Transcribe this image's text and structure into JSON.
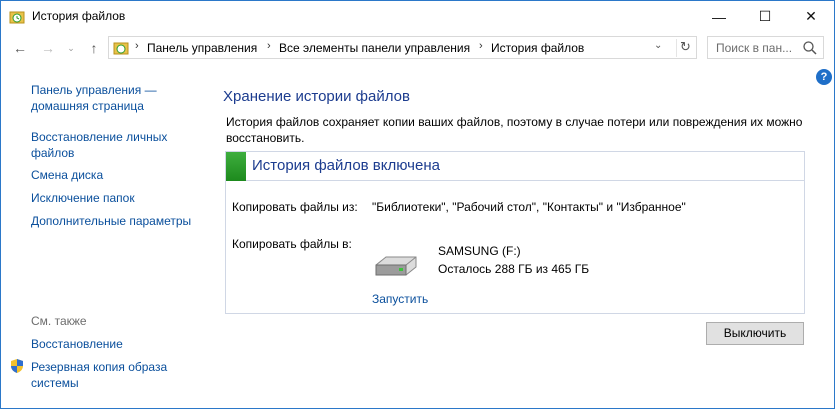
{
  "window": {
    "title": "История файлов",
    "controls": {
      "minimize": "—",
      "maximize": "☐",
      "close": "✕"
    }
  },
  "nav": {
    "back": "←",
    "forward": "→",
    "recent": "⌄",
    "up": "↑",
    "breadcrumbs": [
      "Панель управления",
      "Все элементы панели управления",
      "История файлов"
    ],
    "dropdown": "⌄",
    "refresh": "↻",
    "search_placeholder": "Поиск в пан..."
  },
  "help": "?",
  "sidebar": {
    "items": [
      {
        "label": "Панель управления — домашняя страница"
      },
      {
        "label": "Восстановление личных файлов"
      },
      {
        "label": "Смена диска"
      },
      {
        "label": "Исключение папок"
      },
      {
        "label": "Дополнительные параметры"
      }
    ],
    "see_also_title": "См. также",
    "see_also": [
      {
        "label": "Восстановление"
      },
      {
        "label": "Резервная копия образа системы"
      }
    ]
  },
  "main": {
    "title": "Хранение истории файлов",
    "description": "История файлов сохраняет копии ваших файлов, поэтому в случае потери или повреждения их можно восстановить.",
    "panel": {
      "status": "История файлов включена",
      "copy_from_label": "Копировать файлы из:",
      "copy_from_value": "\"Библиотеки\", \"Рабочий стол\", \"Контакты\" и \"Избранное\"",
      "copy_to_label": "Копировать файлы в:",
      "drive_name": "SAMSUNG (F:)",
      "drive_space": "Осталось 288 ГБ из 465 ГБ",
      "run_link": "Запустить"
    },
    "turn_off_button": "Выключить"
  },
  "colors": {
    "link": "#0a4f9c",
    "heading": "#1c3c8f",
    "status_on": "#2e9e2e",
    "window_border": "#2b78c9"
  }
}
